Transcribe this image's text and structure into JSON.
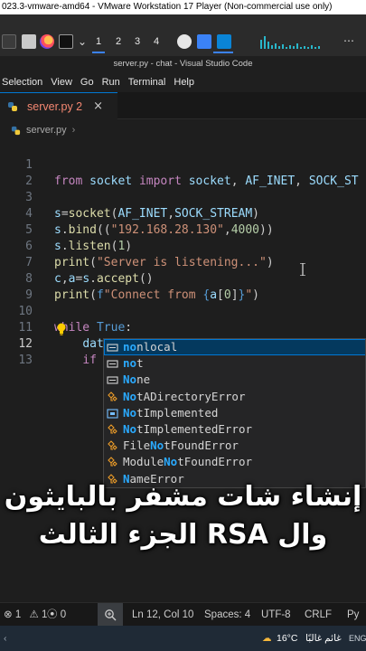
{
  "vmware": {
    "title": "023.3-vmware-amd64 - VMware Workstation 17 Player (Non-commercial use only)"
  },
  "guest_taskbar": {
    "workspaces": [
      "1",
      "2",
      "3",
      "4"
    ]
  },
  "window": {
    "title": "server.py - chat - Visual Studio Code"
  },
  "menu": [
    "Selection",
    "View",
    "Go",
    "Run",
    "Terminal",
    "Help"
  ],
  "tab": {
    "label": "server.py 2",
    "close": "×"
  },
  "breadcrumb": {
    "file": "server.py",
    "separator": "›"
  },
  "editor": {
    "lines": [
      {
        "n": "1",
        "code": "from socket import socket, AF_INET, SOCK_ST"
      },
      {
        "n": "2",
        "code": ""
      },
      {
        "n": "3",
        "code": "s=socket(AF_INET,SOCK_STREAM)"
      },
      {
        "n": "4",
        "code": "s.bind((\"192.168.28.130\",4000))"
      },
      {
        "n": "5",
        "code": "s.listen(1)"
      },
      {
        "n": "6",
        "code": "print(\"Server is listening...\")"
      },
      {
        "n": "7",
        "code": "c,a=s.accept()"
      },
      {
        "n": "8",
        "code": "print(f\"Connect from {a[0]}\")"
      },
      {
        "n": "9",
        "code": ""
      },
      {
        "n": "10",
        "code": "while True:"
      },
      {
        "n": "11",
        "code": "    data=c.recv(1024).decode()"
      },
      {
        "n": "12",
        "code": "    if no"
      },
      {
        "n": "13",
        "code": ""
      }
    ]
  },
  "suggestions": [
    {
      "prefix": "no",
      "rest": "nlocal",
      "pre": "",
      "icon": "keyword-icon",
      "selected": true
    },
    {
      "prefix": "no",
      "rest": "t",
      "pre": "",
      "icon": "keyword-icon",
      "selected": false
    },
    {
      "prefix": "No",
      "rest": "ne",
      "pre": "",
      "icon": "keyword-icon",
      "selected": false
    },
    {
      "prefix": "No",
      "rest": "tADirectoryError",
      "pre": "",
      "icon": "class-icon",
      "selected": false
    },
    {
      "prefix": "No",
      "rest": "tImplemented",
      "pre": "",
      "icon": "variable-icon",
      "selected": false
    },
    {
      "prefix": "No",
      "rest": "tImplementedError",
      "pre": "",
      "icon": "class-icon",
      "selected": false
    },
    {
      "prefix": "No",
      "rest": "tFoundError",
      "pre": "File",
      "icon": "class-icon",
      "selected": false
    },
    {
      "prefix": "No",
      "rest": "tFoundError",
      "pre": "Module",
      "icon": "class-icon",
      "selected": false
    },
    {
      "prefix": "N",
      "rest": "ameError",
      "pre": "",
      "icon": "class-icon",
      "selected": false
    }
  ],
  "caption": {
    "line1": "إنشاء شات مشفر بالبايثون",
    "line2": "وال RSA الجزء الثالث"
  },
  "statusbar": {
    "errors": "1",
    "warnings": "1",
    "ports": "0",
    "position": "Ln 12, Col 10",
    "spaces": "Spaces: 4",
    "encoding": "UTF-8",
    "eol": "CRLF",
    "lang": "Py"
  },
  "windows_taskbar": {
    "temperature": "16°C",
    "weather": "غائم غالبًا",
    "lang": "ENG"
  },
  "colors": {
    "accent": "#0078d4",
    "keyword": "#569cd6",
    "function": "#dcdcaa",
    "string": "#ce9178",
    "number": "#b5cea8",
    "variable": "#9cdcfe",
    "match": "#2aaaff"
  }
}
